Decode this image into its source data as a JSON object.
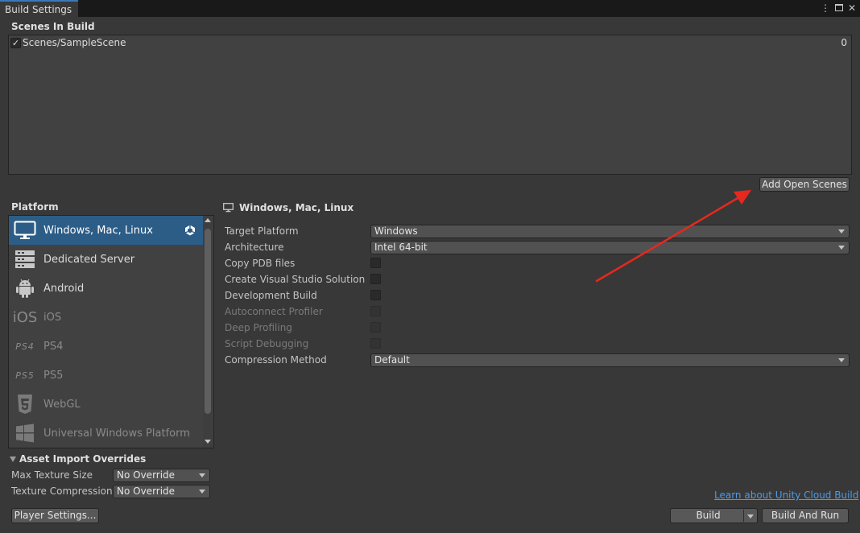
{
  "window": {
    "tab_title": "Build Settings",
    "menu_icon": "kebab-menu-icon",
    "maximize_icon": "maximize-icon",
    "close_icon": "close-icon"
  },
  "scenes": {
    "title": "Scenes In Build",
    "items": [
      {
        "name": "Scenes/SampleScene",
        "checked": true,
        "index": "0"
      }
    ],
    "add_open_scenes_label": "Add Open Scenes"
  },
  "platform": {
    "title": "Platform",
    "items": [
      {
        "label": "Windows, Mac, Linux",
        "icon": "monitor-icon",
        "selected": true,
        "enabled": true,
        "active_icon": "unity-logo-icon"
      },
      {
        "label": "Dedicated Server",
        "icon": "server-icon",
        "selected": false,
        "enabled": true
      },
      {
        "label": "Android",
        "icon": "android-icon",
        "selected": false,
        "enabled": true
      },
      {
        "label": "iOS",
        "icon": "ios-icon",
        "icon_text": "iOS",
        "selected": false,
        "enabled": false
      },
      {
        "label": "PS4",
        "icon": "ps4-icon",
        "icon_text": "PS4",
        "selected": false,
        "enabled": false
      },
      {
        "label": "PS5",
        "icon": "ps5-icon",
        "icon_text": "PS5",
        "selected": false,
        "enabled": false
      },
      {
        "label": "WebGL",
        "icon": "html5-icon",
        "selected": false,
        "enabled": false
      },
      {
        "label": "Universal Windows Platform",
        "icon": "windows-logo-icon",
        "selected": false,
        "enabled": false
      }
    ]
  },
  "settings": {
    "header": "Windows, Mac, Linux",
    "header_icon": "monitor-icon",
    "target_platform": {
      "label": "Target Platform",
      "value": "Windows"
    },
    "architecture": {
      "label": "Architecture",
      "value": "Intel 64-bit"
    },
    "copy_pdb": {
      "label": "Copy PDB files",
      "checked": false
    },
    "create_vs_solution": {
      "label": "Create Visual Studio Solution",
      "checked": false
    },
    "development_build": {
      "label": "Development Build",
      "checked": false
    },
    "autoconnect_profiler": {
      "label": "Autoconnect Profiler",
      "checked": false,
      "enabled": false
    },
    "deep_profiling": {
      "label": "Deep Profiling",
      "checked": false,
      "enabled": false
    },
    "script_debugging": {
      "label": "Script Debugging",
      "checked": false,
      "enabled": false
    },
    "compression_method": {
      "label": "Compression Method",
      "value": "Default"
    }
  },
  "asset_import": {
    "title": "Asset Import Overrides",
    "expanded": true,
    "max_texture_size": {
      "label": "Max Texture Size",
      "value": "No Override"
    },
    "texture_compression": {
      "label": "Texture Compression",
      "value": "No Override"
    }
  },
  "footer": {
    "learn_link": "Learn about Unity Cloud Build",
    "player_settings": "Player Settings...",
    "build": "Build",
    "build_and_run": "Build And Run"
  },
  "annotation": {
    "color": "#e8281e"
  }
}
